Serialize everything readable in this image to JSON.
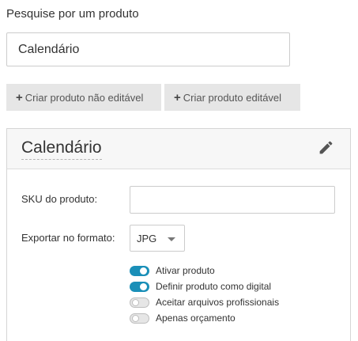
{
  "search": {
    "label": "Pesquise por um produto",
    "value": "Calendário",
    "placeholder": ""
  },
  "actions": {
    "create_noneditable": "Criar produto não editável",
    "create_editable": "Criar produto editável",
    "plus_glyph": "+"
  },
  "product": {
    "title": "Calendário",
    "edit_icon": "pencil-icon",
    "sku_label": "SKU do produto:",
    "sku_value": "",
    "format_label": "Exportar no formato:",
    "format_value": "JPG",
    "toggles": [
      {
        "label": "Ativar produto",
        "on": true
      },
      {
        "label": "Definir produto como digital",
        "on": true
      },
      {
        "label": "Aceitar arquivos profissionais",
        "on": false
      },
      {
        "label": "Apenas orçamento",
        "on": false
      }
    ]
  },
  "colors": {
    "toggle_on": "#1a8fb8",
    "button_bg": "#e6e6e6",
    "header_bg": "#f7f7f7"
  }
}
